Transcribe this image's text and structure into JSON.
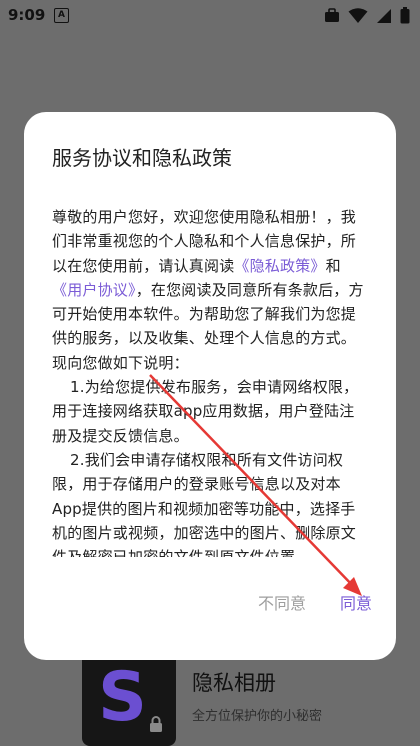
{
  "status_bar": {
    "time": "9:09",
    "notification_icon_letter": "A"
  },
  "dialog": {
    "title": "服务协议和隐私政策",
    "body_intro": "尊敬的用户您好，欢迎您使用隐私相册！，我们非常重视您的个人隐私和个人信息保护，所以在您使用前，请认真阅读",
    "privacy_link": "《隐私政策》",
    "and_text": "和",
    "user_agreement_link": "《用户协议》",
    "body_after_links": "，在您阅读及同意所有条款后，方可开始使用本软件。为帮助您了解我们为您提供的服务，以及收集、处理个人信息的方式。现向您做如下说明：",
    "item_1": "1.为给您提供发布服务，会申请网络权限，用于连接网络获取app应用数据，用户登陆注册及提交反馈信息。",
    "item_2": "2.我们会申请存储权限和所有文件访问权限，用于存储用户的登录账号信息以及对本App提供的图片和视频加密等功能中，选择手机的图片或视频，加密选中的图片、删除原文件及解密已加密的文件到原文件位置。",
    "disagree_label": "不同意",
    "agree_label": "同意"
  },
  "background_app": {
    "name": "隐私相册",
    "description": "全方位保护你的小秘密",
    "icon_letter": "S"
  },
  "colors": {
    "accent": "#7b5cd6",
    "annotation_arrow": "#e53935",
    "scrim": "#6d6d6d"
  }
}
